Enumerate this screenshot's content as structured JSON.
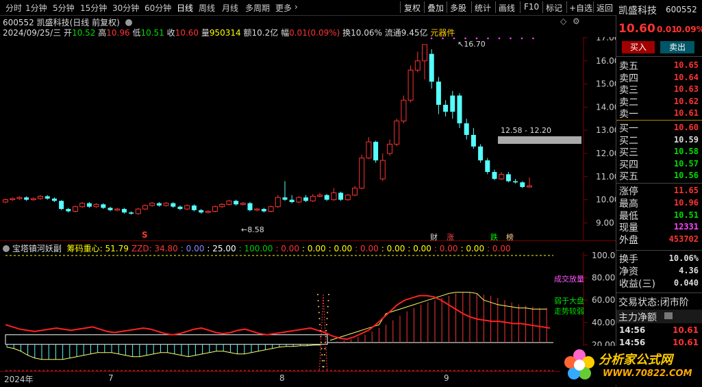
{
  "toolbar": {
    "periods": [
      "分时",
      "1分钟",
      "5分钟",
      "15分钟",
      "30分钟",
      "60分钟",
      "日线",
      "周线",
      "月线",
      "多周期",
      "更多"
    ],
    "active_period": "日线",
    "tools": [
      "复权",
      "叠加",
      "多股",
      "统计",
      "画线",
      "F10",
      "标记",
      "+自选",
      "返回"
    ]
  },
  "header": {
    "title_line": "600552 凯盛科技(日线 前复权)",
    "date": "2024/09/25/三",
    "open_label": "开",
    "open": "10.52",
    "high_label": "高",
    "high": "10.96",
    "low_label": "低",
    "low": "10.51",
    "close_label": "收",
    "close": "10.60",
    "vol_label": "量",
    "vol": "950314",
    "amt_label": "额",
    "amt": "10.2亿",
    "chg_label": "幅",
    "chg": "0.01(0.09%)",
    "turnover_label": "换",
    "turnover": "10.06%",
    "float_label": "流通",
    "float": "9.45亿",
    "sector": "元器件"
  },
  "price_axis": [
    "17.00",
    "16.00",
    "15.00",
    "14.00",
    "13.00",
    "12.00",
    "11.00",
    "10.00",
    "9.00"
  ],
  "annotations": {
    "high_mark": "16.70",
    "low_mark": "8.58",
    "range_box": "12.58 - 12.20",
    "s_mark": "S",
    "tags": [
      "财",
      "涨",
      "跌",
      "榜"
    ]
  },
  "indicator": {
    "name": "宝塔镇河妖副",
    "items": [
      {
        "label": "筹码重心:",
        "value": "51.79",
        "color": "#ffff00"
      },
      {
        "label": "ZZD:",
        "value": "34.80",
        "color": "#ff3333"
      },
      {
        "label": ":",
        "value": "0.00",
        "color": "#8888ff"
      },
      {
        "label": ":",
        "value": "25.00",
        "color": "#ffffff"
      },
      {
        "label": ":",
        "value": "100.00",
        "color": "#00cc00"
      },
      {
        "label": ":",
        "value": "0.00",
        "color": "#ff3333"
      },
      {
        "label": ":",
        "value": "0.00",
        "color": "#ffff00"
      },
      {
        "label": ":",
        "value": "0.00",
        "color": "#ffff00"
      },
      {
        "label": ":",
        "value": "0.00",
        "color": "#ff3333"
      },
      {
        "label": ":",
        "value": "0.00",
        "color": "#ffff00"
      },
      {
        "label": ":",
        "value": "0.00",
        "color": "#ffff00"
      },
      {
        "label": ":",
        "value": "0.00",
        "color": "#ff3333"
      },
      {
        "label": ":",
        "value": "0.00",
        "color": "#ffff00"
      },
      {
        "label": ":",
        "value": "0.00",
        "color": "#ff3333"
      }
    ],
    "axis": [
      "100.0",
      "80.00",
      "60.00",
      "40.00",
      "20.00"
    ],
    "labels": {
      "a": "成交放量",
      "b": "弱于大盘",
      "c": "走势较弱"
    }
  },
  "date_axis": {
    "year": "2024年",
    "months": [
      "7",
      "8",
      "9"
    ]
  },
  "stock": {
    "name": "凯盛科技",
    "code": "600552",
    "price": "10.60",
    "change": "0.01",
    "change_pct": "0.09%"
  },
  "buttons": {
    "buy": "买入",
    "sell": "卖出"
  },
  "orderbook": {
    "sells": [
      {
        "label": "卖五",
        "price": "10.65"
      },
      {
        "label": "卖四",
        "price": "10.64"
      },
      {
        "label": "卖三",
        "price": "10.63"
      },
      {
        "label": "卖二",
        "price": "10.62"
      },
      {
        "label": "卖一",
        "price": "10.61"
      }
    ],
    "buys": [
      {
        "label": "买一",
        "price": "10.60"
      },
      {
        "label": "买二",
        "price": "10.59"
      },
      {
        "label": "买三",
        "price": "10.58"
      },
      {
        "label": "买四",
        "price": "10.57"
      },
      {
        "label": "买五",
        "price": "10.56"
      }
    ]
  },
  "stats": [
    {
      "label": "涨停",
      "value": "11.65",
      "color": "#ff3333"
    },
    {
      "label": "最高",
      "value": "10.96",
      "color": "#ff3333"
    },
    {
      "label": "最低",
      "value": "10.51",
      "color": "#00dd00"
    },
    {
      "label": "现量",
      "value": "12331",
      "color": "#ff44ff"
    },
    {
      "label": "外盘",
      "value": "453702",
      "color": "#ff3333"
    }
  ],
  "extra": [
    {
      "label": "换手",
      "value": "10.06%"
    },
    {
      "label": "净资",
      "value": "4.36"
    },
    {
      "label": "收益(三)",
      "value": "0.040"
    }
  ],
  "trade_status": "交易状态:闭市阶",
  "main_flow": "主力净额",
  "ticks": [
    {
      "time": "14:56",
      "price": "10.61"
    },
    {
      "time": "14:56",
      "price": "10.61"
    }
  ],
  "logo": {
    "line1": "分析家公式网",
    "line2": "WWW.70822.COM"
  },
  "watermark": "分析家公式网www.70822.com",
  "colors": {
    "up": "#ff3333",
    "down": "#54ffff",
    "bg": "#000000",
    "accent": "#ff0000"
  }
}
